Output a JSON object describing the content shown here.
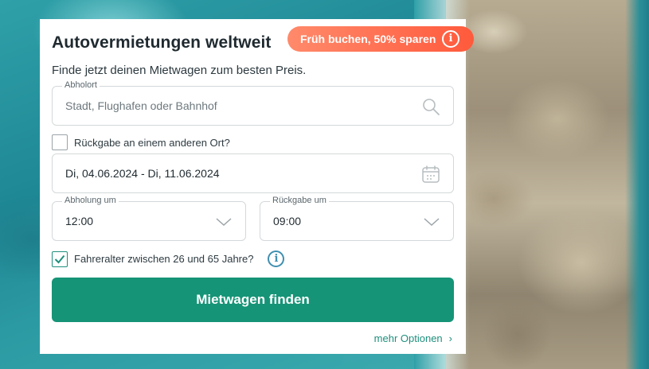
{
  "card": {
    "title": "Autovermietungen weltweit",
    "subtitle": "Finde jetzt deinen Mietwagen zum besten Preis.",
    "promo_label": "Früh buchen, 50% sparen",
    "promo_info_symbol": "i"
  },
  "pickup": {
    "label": "Abholort",
    "placeholder": "Stadt, Flughafen oder Bahnhof"
  },
  "different_return": {
    "label": "Rückgabe an einem anderen Ort?",
    "checked": false
  },
  "dates": {
    "value": "Di, 04.06.2024 - Di, 11.06.2024"
  },
  "pickup_time": {
    "label": "Abholung um",
    "value": "12:00"
  },
  "return_time": {
    "label": "Rückgabe um",
    "value": "09:00"
  },
  "driver_age": {
    "label": "Fahreralter zwischen 26 und 65 Jahre?",
    "checked": true,
    "info_symbol": "i"
  },
  "search_button": {
    "label": "Mietwagen finden"
  },
  "more_options": {
    "label": "mehr Optionen",
    "chevron": "›"
  },
  "colors": {
    "primary": "#169477",
    "promo_start": "#ff8a6b",
    "promo_end": "#ff5a3c",
    "info": "#3f8fb0"
  }
}
